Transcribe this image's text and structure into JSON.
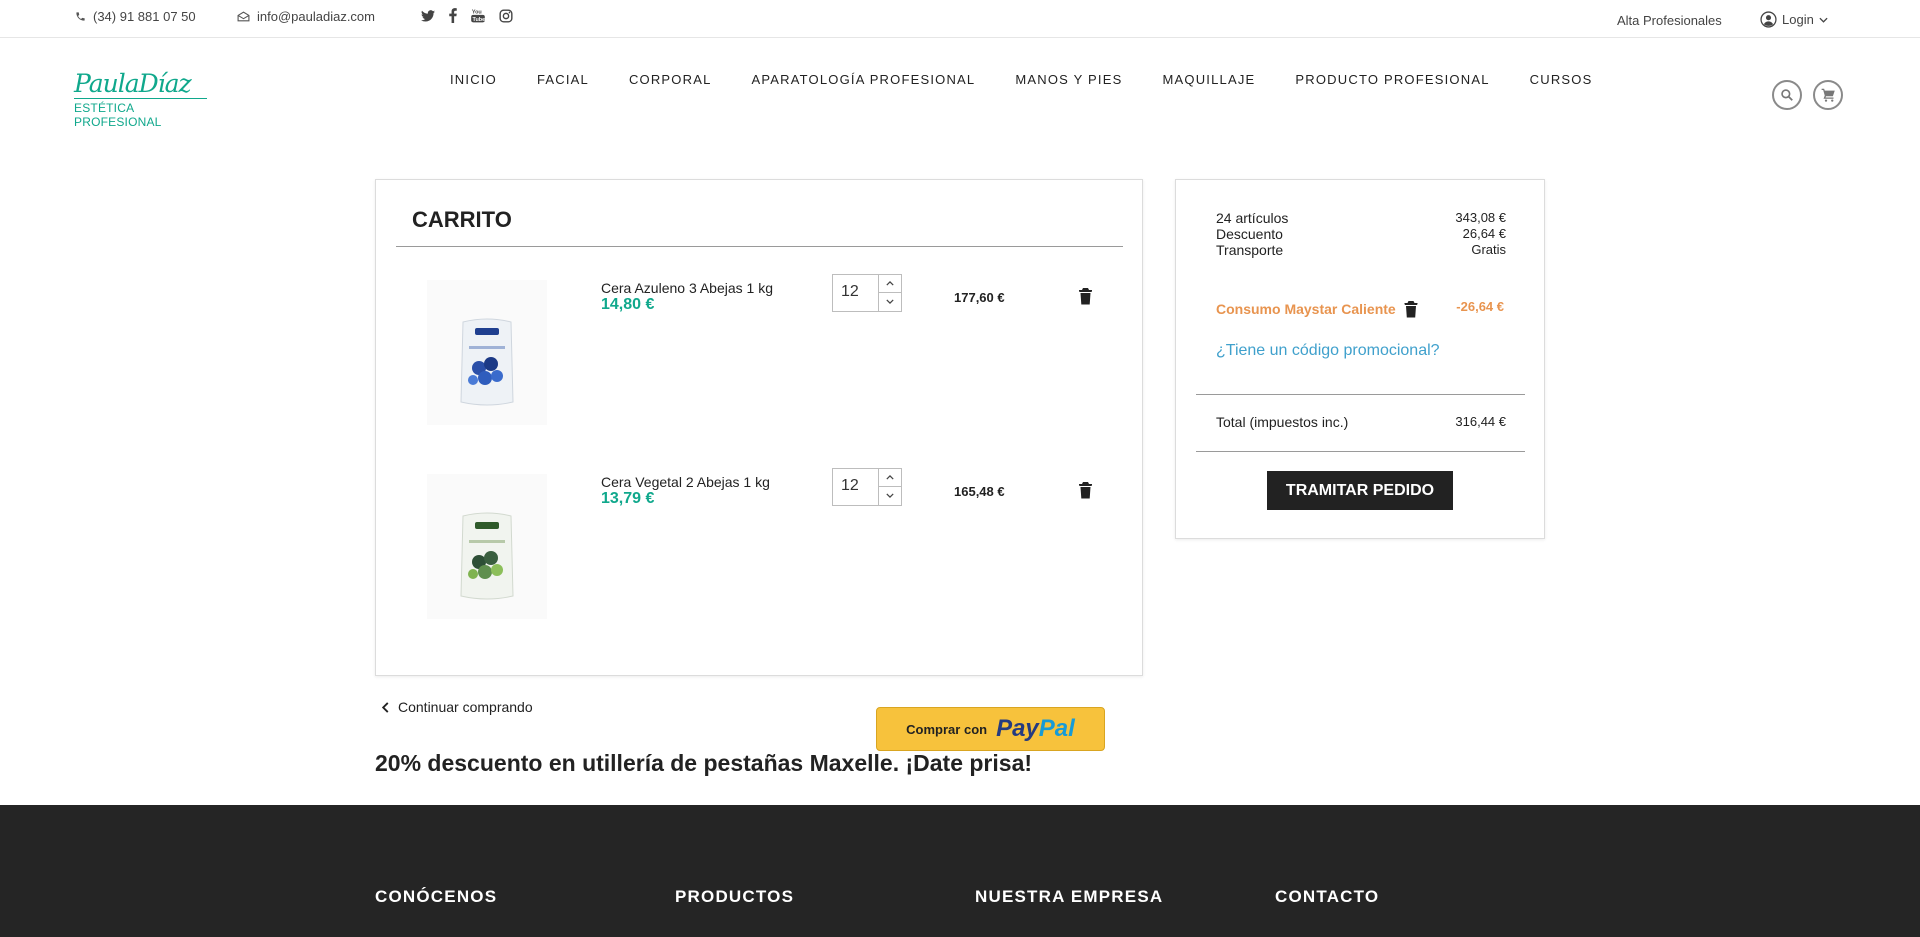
{
  "topbar": {
    "phone": "(34) 91 881 07 50",
    "email": "info@pauladiaz.com",
    "social": [
      "twitter-icon",
      "facebook-icon",
      "youtube-icon",
      "instagram-icon"
    ],
    "pro_signup": "Alta Profesionales",
    "login": "Login"
  },
  "logo": {
    "script": "PaulaDíaz",
    "subtitle": "ESTÉTICA PROFESIONAL"
  },
  "nav": [
    "INICIO",
    "FACIAL",
    "CORPORAL",
    "APARATOLOGÍA PROFESIONAL",
    "MANOS Y PIES",
    "MAQUILLAJE",
    "PRODUCTO PROFESIONAL",
    "CURSOS"
  ],
  "cart": {
    "title": "CARRITO",
    "items": [
      {
        "name": "Cera Azuleno 3 Abejas 1 kg",
        "unit_price": "14,80 €",
        "qty": "12",
        "total": "177,60 €"
      },
      {
        "name": "Cera Vegetal 2 Abejas 1 kg",
        "unit_price": "13,79 €",
        "qty": "12",
        "total": "165,48 €"
      }
    ]
  },
  "summary": {
    "rows": [
      {
        "label": "24 artículos",
        "value": "343,08 €"
      },
      {
        "label": "Descuento",
        "value": "26,64 €"
      },
      {
        "label": "Transporte",
        "value": "Gratis"
      }
    ],
    "promo_applied": "Consumo Maystar Caliente",
    "promo_value": "-26,64 €",
    "promo_link": "¿Tiene un código promocional?",
    "total_label": "Total (impuestos inc.)",
    "total_value": "316,44 €",
    "checkout": "TRAMITAR PEDIDO"
  },
  "continue_shopping": "Continuar comprando",
  "paypal": {
    "prefix": "Comprar con",
    "brand_a": "Pay",
    "brand_b": "Pal"
  },
  "banner": "20% descuento en utillería de pestañas Maxelle. ¡Date prisa!",
  "footer": [
    "CONÓCENOS",
    "PRODUCTOS",
    "NUESTRA EMPRESA",
    "CONTACTO"
  ],
  "colors": {
    "accent": "#10a88c",
    "promo": "#e8944f",
    "link": "#3fa0cc",
    "footer_bg": "#252525"
  }
}
